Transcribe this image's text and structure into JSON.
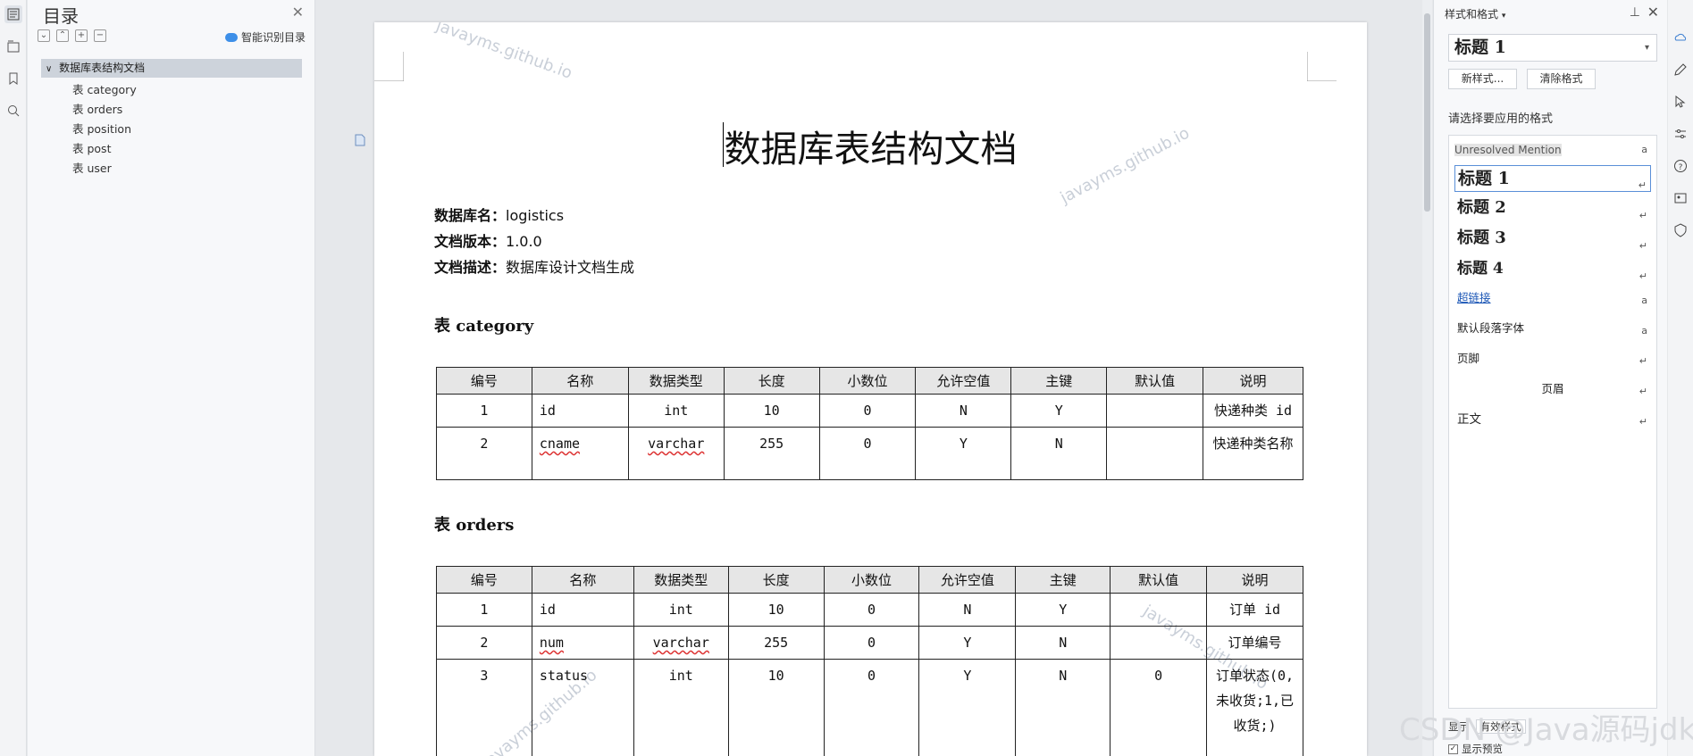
{
  "toc": {
    "title": "目录",
    "smart_label": "智能识别目录",
    "root": "数据库表结构文档",
    "items": [
      "表 category",
      "表 orders",
      "表 position",
      "表 post",
      "表 user"
    ]
  },
  "document": {
    "title": "数据库表结构文档",
    "meta": [
      {
        "label": "数据库名：",
        "value": "logistics"
      },
      {
        "label": "文档版本：",
        "value": "1.0.0"
      },
      {
        "label": "文档描述：",
        "value": "数据库设计文档生成"
      }
    ],
    "headers": [
      "编号",
      "名称",
      "数据类型",
      "长度",
      "小数位",
      "允许空值",
      "主键",
      "默认值",
      "说明"
    ],
    "tables": [
      {
        "heading": "表 category",
        "rows": [
          [
            "1",
            "id",
            "int",
            "10",
            "0",
            "N",
            "Y",
            "",
            "快递种类 id"
          ],
          [
            "2",
            "cname",
            "varchar",
            "255",
            "0",
            "Y",
            "N",
            "",
            "快递种类名称"
          ]
        ]
      },
      {
        "heading": "表 orders",
        "rows": [
          [
            "1",
            "id",
            "int",
            "10",
            "0",
            "N",
            "Y",
            "",
            "订单 id"
          ],
          [
            "2",
            "num",
            "varchar",
            "255",
            "0",
            "Y",
            "N",
            "",
            "订单编号"
          ],
          [
            "3",
            "status",
            "int",
            "10",
            "0",
            "Y",
            "N",
            "0",
            "订单状态(0,未收货;1,已收货;)"
          ]
        ]
      }
    ],
    "watermark": "javayms.github.io"
  },
  "style_panel": {
    "title": "样式和格式",
    "current_style": "标题 1",
    "new_style_button": "新样式...",
    "clear_format_button": "清除格式",
    "apply_label": "请选择要应用的格式",
    "styles": [
      {
        "name": "Unresolved Mention",
        "mark": "a"
      },
      {
        "name": "标题 1",
        "mark": "↵"
      },
      {
        "name": "标题 2",
        "mark": "↵"
      },
      {
        "name": "标题 3",
        "mark": "↵"
      },
      {
        "name": "标题 4",
        "mark": "↵"
      },
      {
        "name": "超链接",
        "mark": "a"
      },
      {
        "name": "默认段落字体",
        "mark": "a"
      },
      {
        "name": "页脚",
        "mark": "↵"
      },
      {
        "name": "页眉",
        "mark": "↵"
      },
      {
        "name": "正文",
        "mark": "↵"
      }
    ],
    "show_label": "显示",
    "show_value": "有效样式",
    "preview_label": "显示预览"
  },
  "csdn_watermark": "CSDN @Java源码jdk"
}
